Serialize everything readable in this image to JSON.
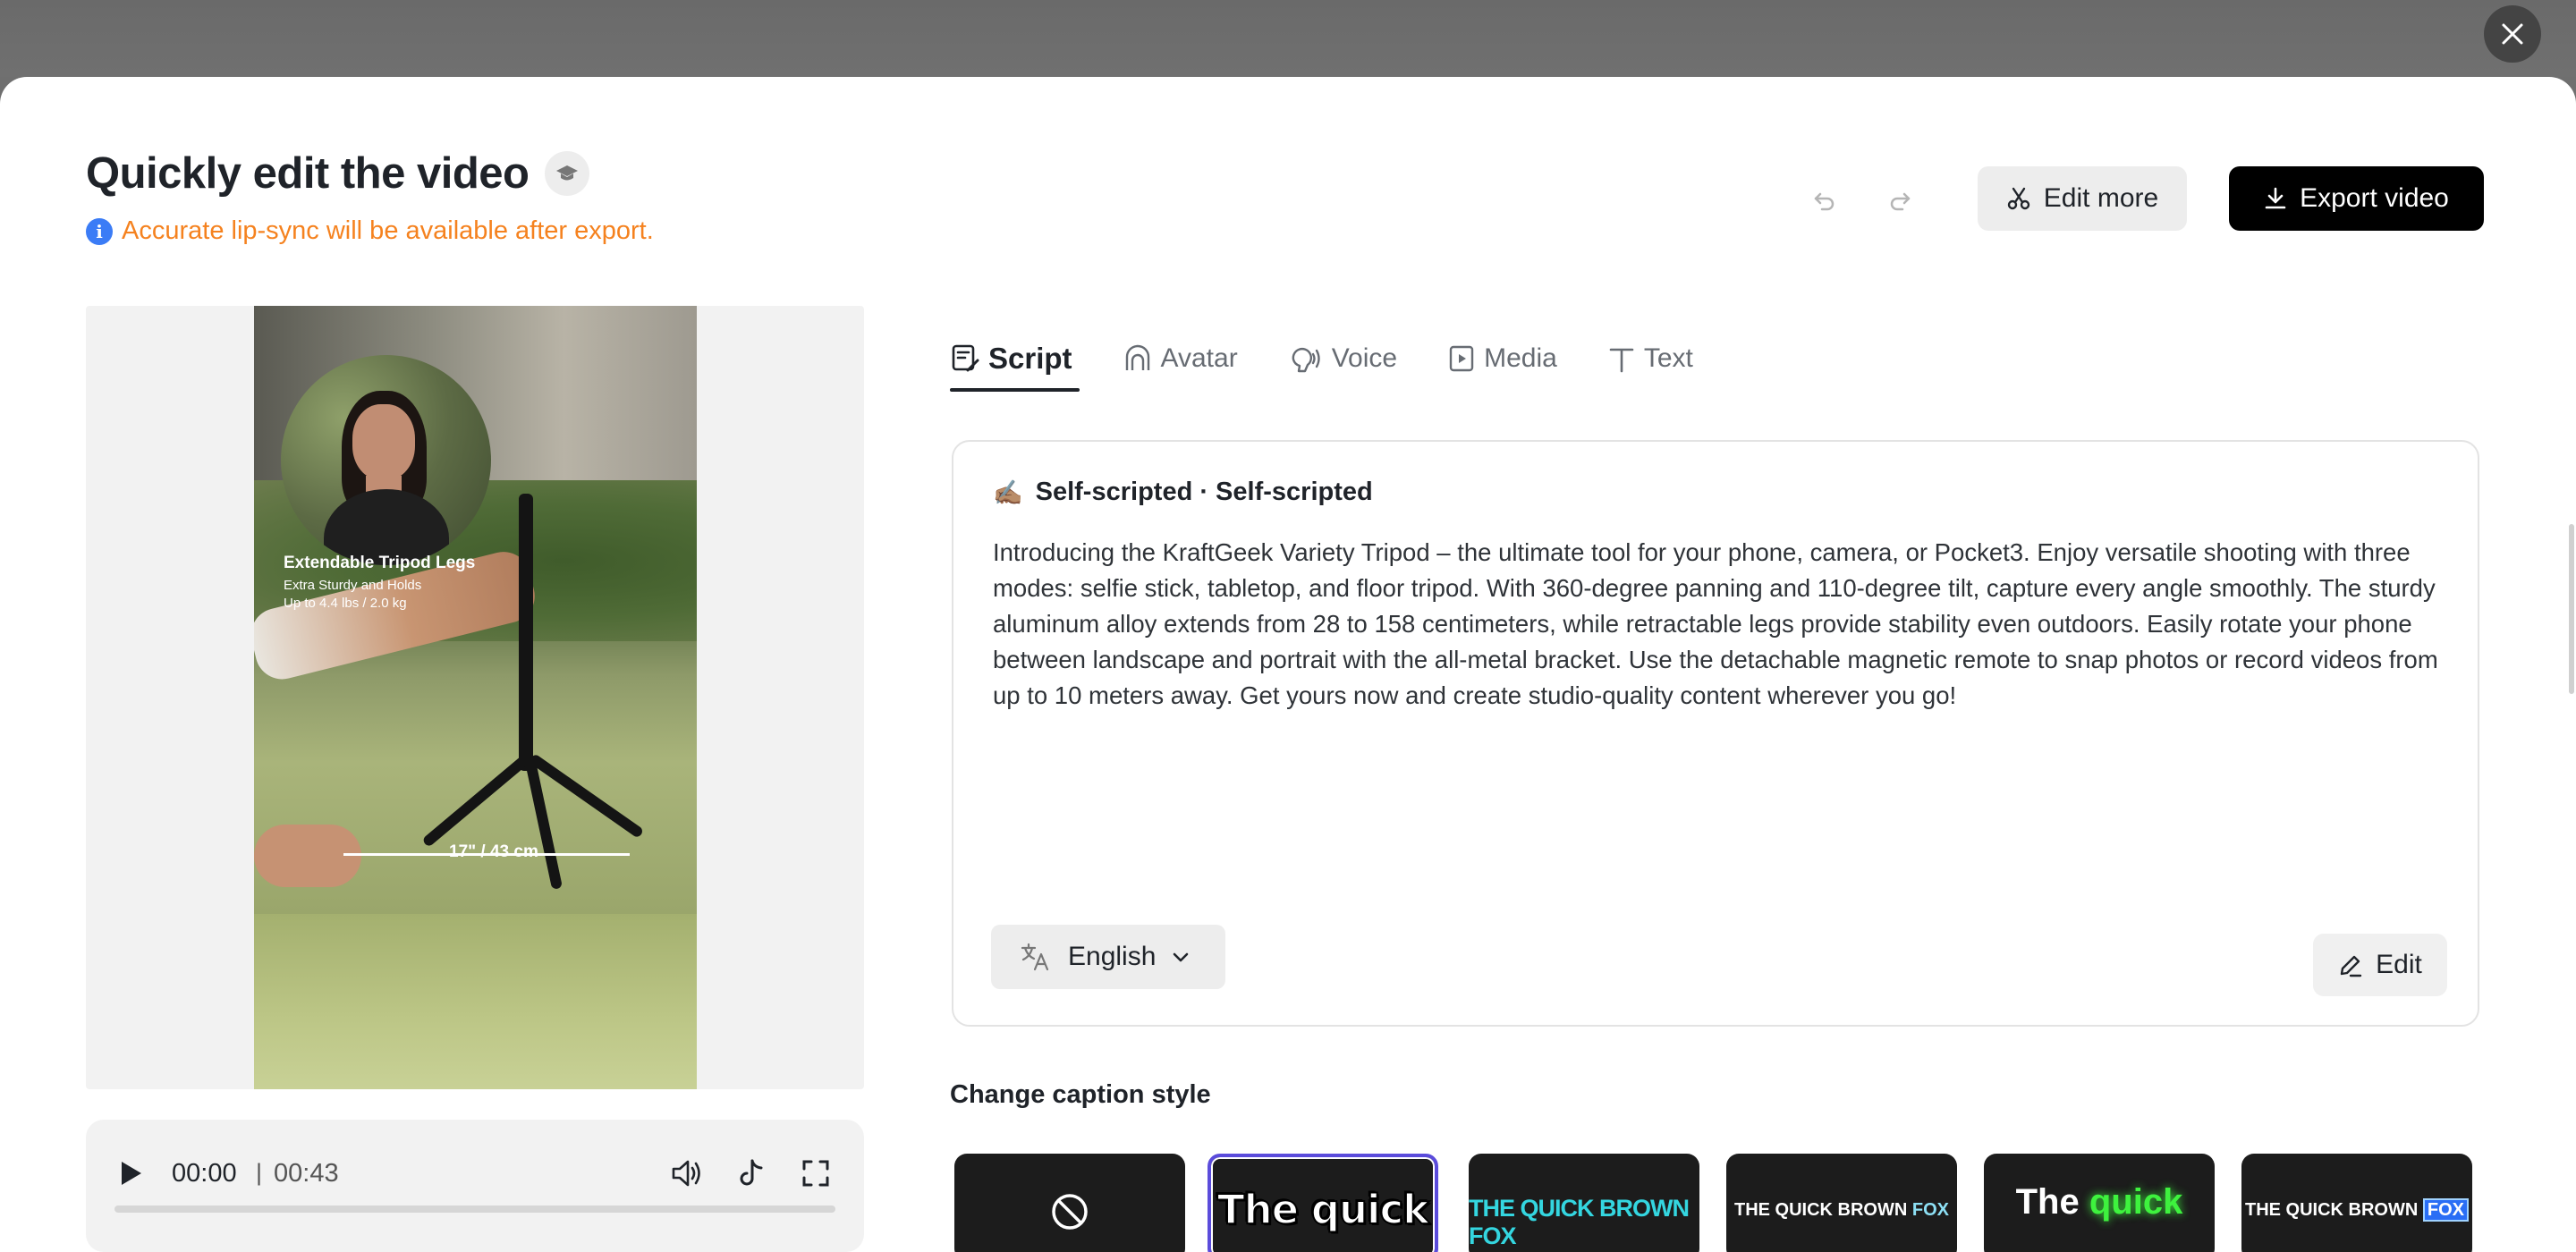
{
  "header": {
    "title": "Quickly edit the video",
    "notice": "Accurate lip-sync will be available after export.",
    "edit_more_label": "Edit more",
    "export_label": "Export video"
  },
  "preview": {
    "overlay_heading": "Extendable Tripod Legs",
    "overlay_line1": "Extra Sturdy and Holds",
    "overlay_line2": "Up to 4.4 lbs / 2.0 kg",
    "dimension": "17\" / 43 cm"
  },
  "player": {
    "current_time": "00:00",
    "separator": "|",
    "total_time": "00:43",
    "progress": 0
  },
  "tabs": [
    {
      "label": "Script",
      "icon": "script-icon",
      "active": true
    },
    {
      "label": "Avatar",
      "icon": "avatar-icon",
      "active": false
    },
    {
      "label": "Voice",
      "icon": "voice-icon",
      "active": false
    },
    {
      "label": "Media",
      "icon": "media-icon",
      "active": false
    },
    {
      "label": "Text",
      "icon": "text-icon",
      "active": false
    }
  ],
  "script": {
    "heading_emoji": "✍🏽",
    "heading": "Self-scripted · Self-scripted",
    "body": "Introducing the KraftGeek Variety Tripod – the ultimate tool for your phone, camera, or Pocket3. Enjoy versatile shooting with three modes: selfie stick, tabletop, and floor tripod. With 360-degree panning and 110-degree tilt, capture every angle smoothly. The sturdy aluminum alloy extends from 28 to 158 centimeters, while retractable legs provide stability even outdoors. Easily rotate your phone between landscape and portrait with the all-metal bracket. Use the detachable magnetic remote to snap photos or record videos from up to 10 meters away. Get yours now and create studio-quality content wherever you go!",
    "language": "English",
    "edit_label": "Edit"
  },
  "captions": {
    "title": "Change caption style",
    "styles": [
      {
        "id": "none",
        "text": ""
      },
      {
        "id": "outline",
        "text": "The quick"
      },
      {
        "id": "condensed-cyan",
        "text": "THE QUICK BROWN FOX"
      },
      {
        "id": "small-caps-highlight",
        "text": "THE QUICK BROWN",
        "highlight": "FOX"
      },
      {
        "id": "green-glow",
        "text": "The",
        "highlight": "quick"
      },
      {
        "id": "boxed-highlight",
        "text": "THE QUICK BROWN",
        "highlight": "FOX"
      }
    ]
  },
  "colors": {
    "notice": "#f5821f",
    "info_icon": "#3b7cf6",
    "export_bg": "#000000",
    "selected_caption_border": "#5b4cdb"
  }
}
